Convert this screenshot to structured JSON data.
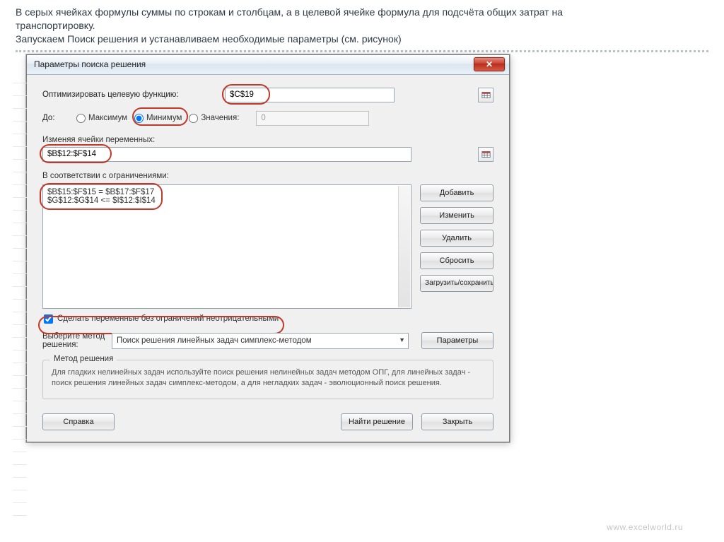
{
  "intro": {
    "line1_a": "В серых ячейках формулы суммы по строкам и столбцам, а в целевой ячейке формула для подсчёта общих затрат на",
    "line1_b": "транспортировку.",
    "line2": "Запускаем Поиск решения и устанавливаем необходимые параметры (см. рисунок)"
  },
  "dialog": {
    "title": "Параметры поиска решения",
    "objective_label": "Оптимизировать целевую функцию:",
    "objective_value": "$C$19",
    "to_label": "До:",
    "radio_max": "Максимум",
    "radio_min": "Минимум",
    "radio_val_label": "Значения:",
    "radio_val_value": "0",
    "changing_label": "Изменяя ячейки переменных:",
    "changing_value": "$B$12:$F$14",
    "constraints_label": "В соответствии с ограничениями:",
    "constraints": {
      "c1": "$B$15:$F$15 = $B$17:$F$17",
      "c2": "$G$12:$G$14 <= $I$12:$I$14"
    },
    "btn_add": "Добавить",
    "btn_change": "Изменить",
    "btn_delete": "Удалить",
    "btn_reset": "Сбросить",
    "btn_load": "Загрузить/сохранить",
    "check_nonneg": "Сделать переменные без ограничений неотрицательными",
    "method_label": "Выберите метод решения:",
    "method_value": "Поиск решения линейных задач симплекс-методом",
    "btn_params": "Параметры",
    "group_title": "Метод решения",
    "group_text": "Для гладких нелинейных задач используйте поиск решения нелинейных задач методом ОПГ, для линейных задач - поиск решения линейных задач симплекс-методом, а для негладких задач - эволюционный поиск решения.",
    "btn_help": "Справка",
    "btn_solve": "Найти решение",
    "btn_close": "Закрыть"
  },
  "watermark": "www.excelworld.ru"
}
